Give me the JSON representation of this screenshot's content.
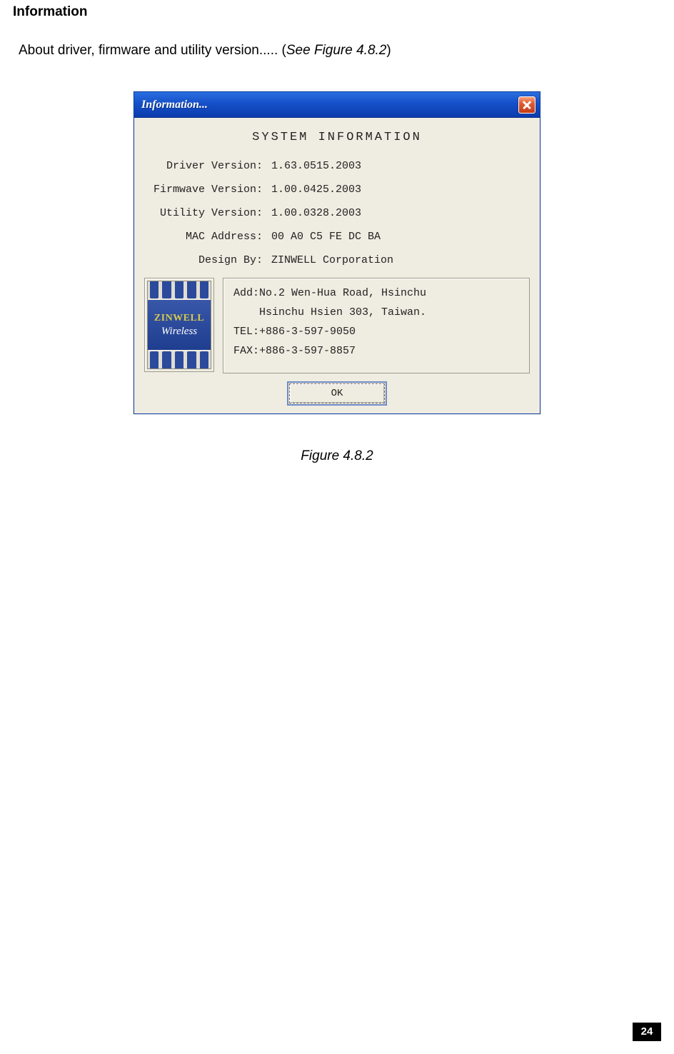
{
  "heading": "Information",
  "intro": {
    "prefix": "About driver, firmware and utility version..... (",
    "italic": "See Figure 4.8.2",
    "suffix": ")"
  },
  "dialog": {
    "title": "Information...",
    "system_title": "SYSTEM  INFORMATION",
    "rows": [
      {
        "label": "Driver Version:",
        "value": "1.63.0515.2003"
      },
      {
        "label": "Firmwave Version:",
        "value": "1.00.0425.2003"
      },
      {
        "label": "Utility Version:",
        "value": "1.00.0328.2003"
      },
      {
        "label": "MAC Address:",
        "value": "00 A0 C5 FE DC BA"
      },
      {
        "label": "Design By:",
        "value": "ZINWELL Corporation"
      }
    ],
    "logo": {
      "brand": "ZINWELL",
      "tagline": "Wireless"
    },
    "address": {
      "line1": "Add:No.2 Wen-Hua Road, Hsinchu",
      "line2": "Hsinchu Hsien 303, Taiwan.",
      "tel": "TEL:+886-3-597-9050",
      "fax": "FAX:+886-3-597-8857"
    },
    "ok_label": "OK"
  },
  "caption": "Figure 4.8.2",
  "page_number": "24"
}
